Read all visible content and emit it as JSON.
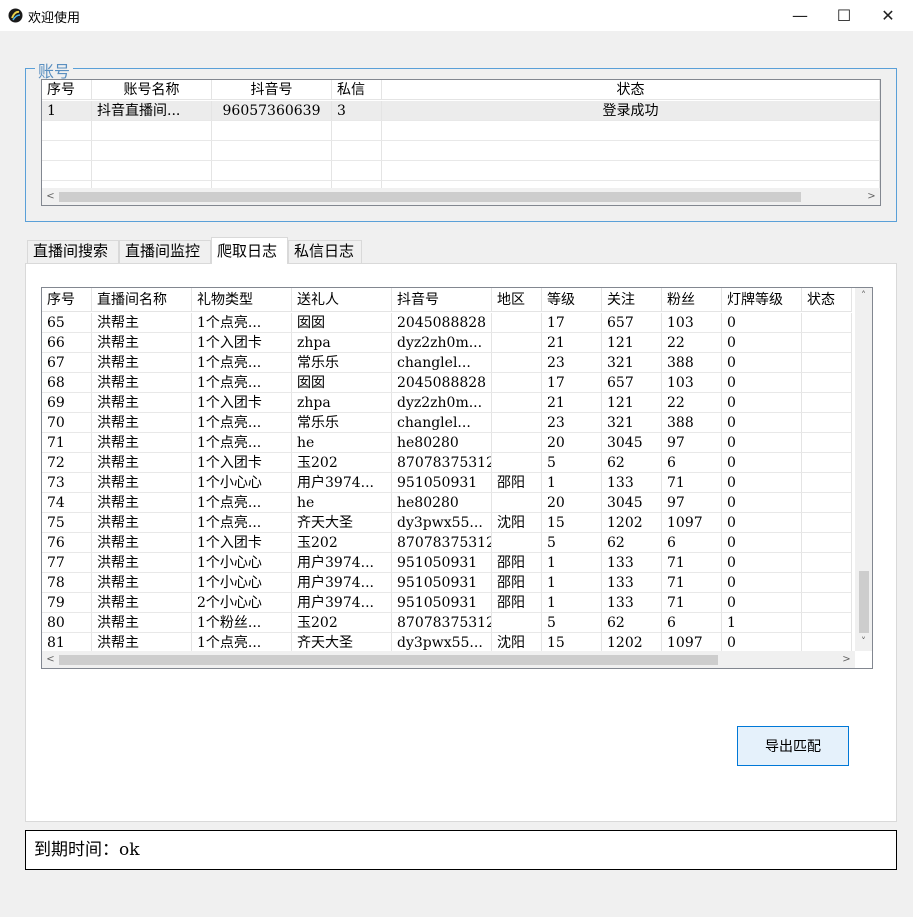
{
  "window": {
    "title": "欢迎使用",
    "minimize_glyph": "—",
    "maximize_glyph": "☐",
    "close_glyph": "✕"
  },
  "account_group": {
    "label": "账号",
    "columns": [
      "序号",
      "账号名称",
      "抖音号",
      "私信",
      "状态"
    ],
    "rows": [
      [
        "1",
        "抖音直播间...",
        "96057360639",
        "3",
        "登录成功"
      ]
    ],
    "empty_rows": 4
  },
  "tabs": [
    {
      "label": "直播间搜索",
      "active": false
    },
    {
      "label": "直播间监控",
      "active": false
    },
    {
      "label": "爬取日志",
      "active": true
    },
    {
      "label": "私信日志",
      "active": false
    }
  ],
  "log_table": {
    "columns": [
      "序号",
      "直播间名称",
      "礼物类型",
      "送礼人",
      "抖音号",
      "地区",
      "等级",
      "关注",
      "粉丝",
      "灯牌等级",
      "状态"
    ],
    "rows": [
      [
        "65",
        "洪帮主",
        "1个点亮...",
        "囡囡",
        "2045088828",
        "",
        "17",
        "657",
        "103",
        "0",
        ""
      ],
      [
        "66",
        "洪帮主",
        "1个入团卡",
        "zhpa",
        "dyz2zh0m...",
        "",
        "21",
        "121",
        "22",
        "0",
        ""
      ],
      [
        "67",
        "洪帮主",
        "1个点亮...",
        "常乐乐",
        "changlel...",
        "",
        "23",
        "321",
        "388",
        "0",
        ""
      ],
      [
        "68",
        "洪帮主",
        "1个点亮...",
        "囡囡",
        "2045088828",
        "",
        "17",
        "657",
        "103",
        "0",
        ""
      ],
      [
        "69",
        "洪帮主",
        "1个入团卡",
        "zhpa",
        "dyz2zh0m...",
        "",
        "21",
        "121",
        "22",
        "0",
        ""
      ],
      [
        "70",
        "洪帮主",
        "1个点亮...",
        "常乐乐",
        "changlel...",
        "",
        "23",
        "321",
        "388",
        "0",
        ""
      ],
      [
        "71",
        "洪帮主",
        "1个点亮...",
        "he",
        "he80280",
        "",
        "20",
        "3045",
        "97",
        "0",
        ""
      ],
      [
        "72",
        "洪帮主",
        "1个入团卡",
        "玉202",
        "87078375312",
        "",
        "5",
        "62",
        "6",
        "0",
        ""
      ],
      [
        "73",
        "洪帮主",
        "1个小心心",
        "用户3974...",
        "951050931",
        "邵阳",
        "1",
        "133",
        "71",
        "0",
        ""
      ],
      [
        "74",
        "洪帮主",
        "1个点亮...",
        "he",
        "he80280",
        "",
        "20",
        "3045",
        "97",
        "0",
        ""
      ],
      [
        "75",
        "洪帮主",
        "1个点亮...",
        "齐天大圣",
        "dy3pwx55...",
        "沈阳",
        "15",
        "1202",
        "1097",
        "0",
        ""
      ],
      [
        "76",
        "洪帮主",
        "1个入团卡",
        "玉202",
        "87078375312",
        "",
        "5",
        "62",
        "6",
        "0",
        ""
      ],
      [
        "77",
        "洪帮主",
        "1个小心心",
        "用户3974...",
        "951050931",
        "邵阳",
        "1",
        "133",
        "71",
        "0",
        ""
      ],
      [
        "78",
        "洪帮主",
        "1个小心心",
        "用户3974...",
        "951050931",
        "邵阳",
        "1",
        "133",
        "71",
        "0",
        ""
      ],
      [
        "79",
        "洪帮主",
        "2个小心心",
        "用户3974...",
        "951050931",
        "邵阳",
        "1",
        "133",
        "71",
        "0",
        ""
      ],
      [
        "80",
        "洪帮主",
        "1个粉丝...",
        "玉202",
        "87078375312",
        "",
        "5",
        "62",
        "6",
        "1",
        ""
      ],
      [
        "81",
        "洪帮主",
        "1个点亮...",
        "齐天大圣",
        "dy3pwx55...",
        "沈阳",
        "15",
        "1202",
        "1097",
        "0",
        ""
      ]
    ]
  },
  "export_button": {
    "label": "导出匹配"
  },
  "expiry": {
    "text": "到期时间：ok"
  },
  "scroll_arrows": {
    "left": "<",
    "right": ">",
    "up": "˄",
    "down": "˅"
  },
  "colors": {
    "accent": "#0078d7",
    "group_border": "#5aa0d8",
    "selected_row": "#ececec"
  }
}
